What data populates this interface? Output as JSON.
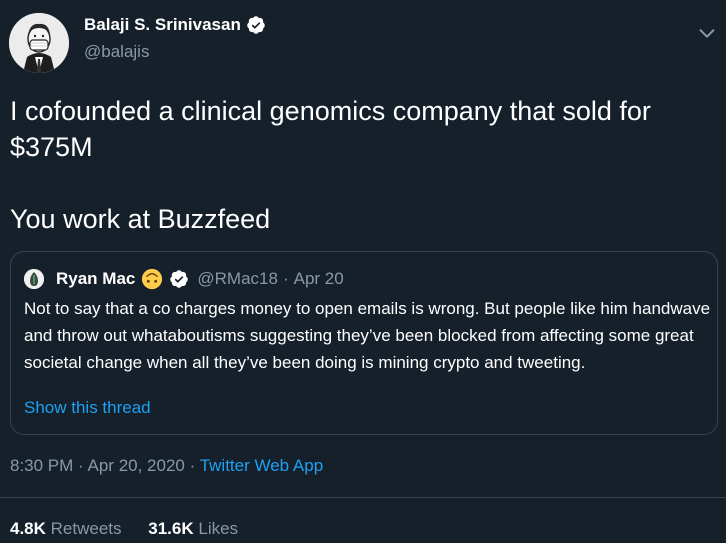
{
  "author": {
    "name": "Balaji S. Srinivasan",
    "handle": "@balajis"
  },
  "tweet": {
    "text": "I cofounded a clinical genomics company that sold for $375M\n\nYou work at Buzzfeed"
  },
  "quote": {
    "name": "Ryan Mac",
    "handle": "@RMac18",
    "separator": "·",
    "date": "Apr 20",
    "text": "Not to say that a co charges money to open emails is wrong. But people like him handwave and throw out whataboutisms suggesting they’ve been blocked from affecting some great societal change when all they’ve been doing is mining crypto and tweeting.",
    "show_thread": "Show this thread"
  },
  "meta": {
    "time": "8:30 PM",
    "separator": "·",
    "date": "Apr 20, 2020",
    "source": "Twitter Web App"
  },
  "stats": {
    "retweets_count": "4.8K",
    "retweets_label": "Retweets",
    "likes_count": "31.6K",
    "likes_label": "Likes"
  },
  "colors": {
    "background": "#15202b",
    "accent": "#1da1f2",
    "secondary_text": "#8899a6",
    "border": "#38444d"
  },
  "icons": {
    "verified": "verified-badge-icon",
    "caret": "chevron-down-icon",
    "emoji": "upside-down-face-emoji"
  }
}
